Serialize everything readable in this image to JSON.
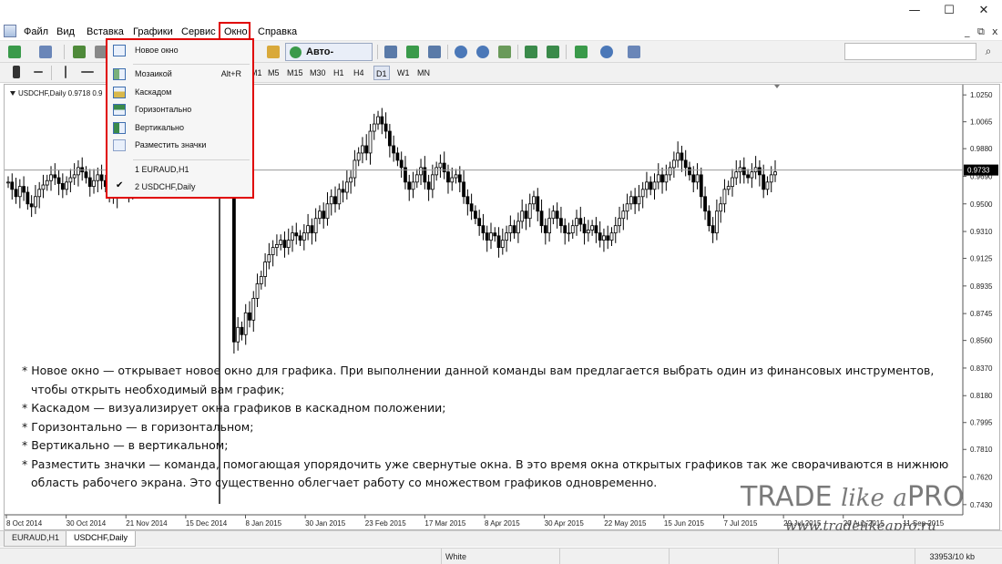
{
  "window": {
    "minimize_glyph": "—",
    "maximize_glyph": "☐",
    "close_glyph": "✕"
  },
  "menu": {
    "items": [
      "Файл",
      "Вид",
      "Вставка",
      "Графики",
      "Сервис",
      "Окно",
      "Справка"
    ],
    "right_minimize": "_",
    "right_restore": "⧉",
    "right_close": "x"
  },
  "toolbar": {
    "autotrade_label": "Авто-торговля",
    "timeframes": [
      "M1",
      "M5",
      "M15",
      "M30",
      "H1",
      "H4",
      "D1",
      "W1",
      "MN"
    ],
    "active_timeframe": "D1"
  },
  "window_menu": {
    "items": [
      {
        "label": "Новое окно",
        "shortcut": "",
        "icon": "new-window-icon"
      },
      {
        "label": "Мозаикой",
        "shortcut": "Alt+R",
        "icon": "tile-icon"
      },
      {
        "label": "Каскадом",
        "shortcut": "",
        "icon": "cascade-icon"
      },
      {
        "label": "Горизонтально",
        "shortcut": "",
        "icon": "horizontal-icon"
      },
      {
        "label": "Вертикально",
        "shortcut": "",
        "icon": "vertical-icon"
      },
      {
        "label": "Разместить значки",
        "shortcut": "",
        "icon": "arrange-icons-icon"
      },
      {
        "label": "1 EURAUD,H1",
        "shortcut": "",
        "icon": ""
      },
      {
        "label": "2 USDCHF,Daily",
        "shortcut": "",
        "icon": "check-icon",
        "checked": true
      }
    ]
  },
  "chart": {
    "header": "USDCHF,Daily  0.9718 0.9",
    "current_price_label": "0.9733"
  },
  "chart_data": {
    "type": "candlestick",
    "symbol": "USDCHF",
    "timeframe": "Daily",
    "y_ticks": [
      "1.0250",
      "1.0065",
      "0.9880",
      "0.9690",
      "0.9500",
      "0.9310",
      "0.9125",
      "0.8935",
      "0.8745",
      "0.8560",
      "0.8370",
      "0.8180",
      "0.7995",
      "0.7810",
      "0.7620",
      "0.7430"
    ],
    "x_ticks": [
      "8 Oct 2014",
      "30 Oct 2014",
      "21 Nov 2014",
      "15 Dec 2014",
      "8 Jan 2015",
      "30 Jan 2015",
      "23 Feb 2015",
      "17 Mar 2015",
      "8 Apr 2015",
      "30 Apr 2015",
      "22 May 2015",
      "15 Jun 2015",
      "7 Jul 2015",
      "29 Jul 2015",
      "20 Aug 2015",
      "11 Sep 2015"
    ],
    "ylim": [
      0.736,
      1.032
    ],
    "current_price": 0.9733,
    "closes": [
      0.965,
      0.96,
      0.955,
      0.962,
      0.958,
      0.95,
      0.948,
      0.955,
      0.96,
      0.963,
      0.966,
      0.97,
      0.968,
      0.964,
      0.96,
      0.965,
      0.968,
      0.97,
      0.975,
      0.972,
      0.968,
      0.962,
      0.966,
      0.97,
      0.966,
      0.962,
      0.958,
      0.955,
      0.96,
      0.965,
      0.962,
      0.958,
      0.962,
      0.965,
      0.97,
      0.968,
      0.965,
      0.968,
      0.97,
      0.972,
      0.975,
      0.972,
      0.97,
      0.968,
      0.972,
      0.975,
      0.972,
      0.97,
      0.97,
      0.972,
      0.968,
      0.965,
      0.968,
      0.975,
      0.97,
      0.975,
      0.97,
      0.972,
      0.855,
      0.865,
      0.86,
      0.875,
      0.87,
      0.885,
      0.895,
      0.9,
      0.91,
      0.915,
      0.92,
      0.922,
      0.925,
      0.92,
      0.925,
      0.93,
      0.928,
      0.925,
      0.93,
      0.935,
      0.93,
      0.94,
      0.945,
      0.94,
      0.95,
      0.955,
      0.95,
      0.96,
      0.958,
      0.965,
      0.968,
      0.98,
      0.985,
      0.99,
      0.985,
      1.0,
      1.005,
      1.01,
      1.005,
      1.0,
      0.99,
      0.985,
      0.98,
      0.975,
      0.965,
      0.96,
      0.965,
      0.97,
      0.975,
      0.965,
      0.96,
      0.97,
      0.975,
      0.978,
      0.972,
      0.965,
      0.968,
      0.97,
      0.965,
      0.955,
      0.95,
      0.945,
      0.94,
      0.935,
      0.93,
      0.925,
      0.93,
      0.928,
      0.92,
      0.925,
      0.93,
      0.935,
      0.93,
      0.938,
      0.945,
      0.94,
      0.95,
      0.955,
      0.945,
      0.935,
      0.93,
      0.94,
      0.945,
      0.94,
      0.935,
      0.93,
      0.93,
      0.935,
      0.94,
      0.936,
      0.93,
      0.932,
      0.935,
      0.93,
      0.925,
      0.928,
      0.925,
      0.93,
      0.935,
      0.94,
      0.945,
      0.95,
      0.955,
      0.95,
      0.955,
      0.96,
      0.965,
      0.96,
      0.965,
      0.97,
      0.965,
      0.97,
      0.975,
      0.98,
      0.985,
      0.98,
      0.975,
      0.97,
      0.965,
      0.97,
      0.955,
      0.945,
      0.935,
      0.93,
      0.945,
      0.95,
      0.96,
      0.962,
      0.968,
      0.972,
      0.975,
      0.97,
      0.968,
      0.972,
      0.975,
      0.97,
      0.96,
      0.965,
      0.97,
      0.972
    ]
  },
  "tabs": [
    "EURAUD,H1",
    "USDCHF,Daily"
  ],
  "active_tab": "USDCHF,Daily",
  "status": {
    "profile": "White",
    "traffic": "33953/10 kb"
  },
  "notes": [
    "* Новое окно — открывает новое окно для графика. При выполнении данной команды вам предлагается выбрать один из финансовых инструментов,",
    "чтобы открыть необходимый вам график;",
    "* Каскадом — визуализирует окна графиков в каскадном положении;",
    "* Горизонтально — в горизонтальном;",
    "* Вертикально — в вертикальном;",
    "* Разместить значки — команда, помогающая упорядочить уже свернутые окна. В это время окна открытых графиков так же сворачиваются в нижнюю",
    "область рабочего экрана. Это существенно облегчает работу со множеством графиков одновременно."
  ],
  "watermark": {
    "brand_trade": "TRADE",
    "brand_like": "like",
    "brand_a": "a",
    "brand_pro": "PRO",
    "url": "www.tradelikeapro.ru"
  }
}
